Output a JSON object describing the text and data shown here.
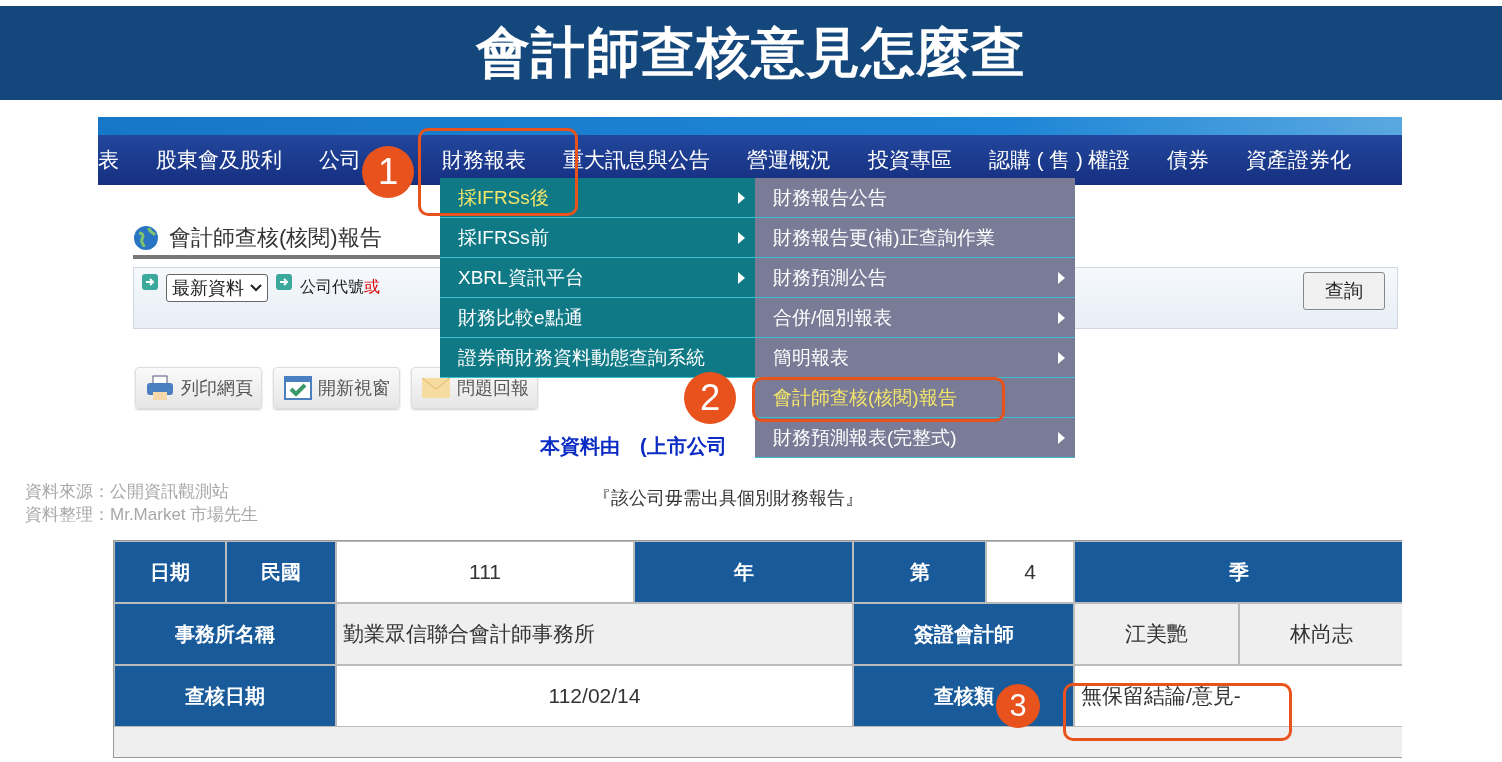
{
  "banner": {
    "title": "會計師查核意見怎麼查"
  },
  "nav": {
    "items": [
      "表",
      "股東會及股利",
      "公司",
      "財務報表",
      "重大訊息與公告",
      "營運概況",
      "投資專區",
      "認購 ( 售 ) 權證",
      "債券",
      "資產證券化"
    ]
  },
  "menu": {
    "items": [
      {
        "label": "採IFRSs後",
        "submenu": true,
        "selected": true
      },
      {
        "label": "採IFRSs前",
        "submenu": true,
        "selected": false
      },
      {
        "label": "XBRL資訊平台",
        "submenu": true,
        "selected": false
      },
      {
        "label": "財務比較e點通",
        "submenu": false,
        "selected": false
      },
      {
        "label": "證券商財務資料動態查詢系統",
        "submenu": false,
        "selected": false
      }
    ]
  },
  "submenu": {
    "items": [
      {
        "label": "財務報告公告",
        "submenu": false,
        "selected": false
      },
      {
        "label": "財務報告更(補)正查詢作業",
        "submenu": false,
        "selected": false
      },
      {
        "label": "財務預測公告",
        "submenu": true,
        "selected": false
      },
      {
        "label": "合併/個別報表",
        "submenu": true,
        "selected": false
      },
      {
        "label": "簡明報表",
        "submenu": true,
        "selected": false
      },
      {
        "label": "會計師查核(核閱)報告",
        "submenu": false,
        "selected": true
      },
      {
        "label": "財務預測報表(完整式)",
        "submenu": true,
        "selected": false
      }
    ]
  },
  "page": {
    "title": "會計師查核(核閱)報告",
    "period": "最新資料",
    "company_label": "公司代號",
    "company_label_red": "或",
    "button": "查詢",
    "tools": [
      {
        "kind": "print",
        "label": "列印網頁"
      },
      {
        "kind": "window",
        "label": "開新視窗"
      },
      {
        "kind": "mail",
        "label": "問題回報"
      }
    ],
    "notice": "本資料由　(上市公司",
    "note": "『該公司毋需出具個別財務報告』"
  },
  "table": {
    "rows": [
      [
        {
          "text": "日期",
          "kind": "header"
        },
        {
          "text": "民國",
          "kind": "header"
        },
        {
          "text": "111",
          "kind": "value"
        },
        {
          "text": "年",
          "kind": "header"
        },
        {
          "text": "第",
          "kind": "header"
        },
        {
          "text": "4",
          "kind": "value"
        },
        {
          "text": "季",
          "kind": "header"
        }
      ],
      [
        {
          "text": "事務所名稱",
          "kind": "header"
        },
        {
          "text": "勤業眾信聯合會計師事務所",
          "kind": "value"
        },
        {
          "text": "簽證會計師",
          "kind": "header"
        },
        {
          "text": "江美艷",
          "kind": "value"
        },
        {
          "text": "林尚志",
          "kind": "value"
        }
      ],
      [
        {
          "text": "查核日期",
          "kind": "header"
        },
        {
          "text": "112/02/14",
          "kind": "value"
        },
        {
          "text": "查核類",
          "kind": "header"
        },
        {
          "text": "無保留結論/意見-",
          "kind": "value"
        }
      ]
    ]
  },
  "steps": [
    "1",
    "2",
    "3"
  ],
  "source": [
    "資料來源：公開資訊觀測站",
    "資料整理：Mr.Market 市場先生"
  ]
}
